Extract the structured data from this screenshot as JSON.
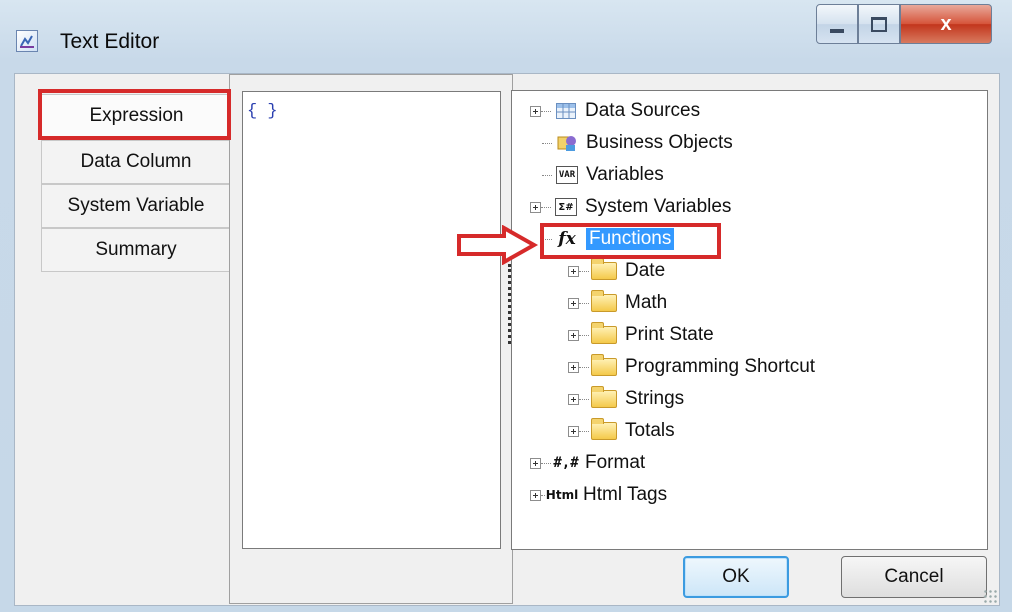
{
  "window": {
    "title": "Text Editor",
    "minimize_icon": "minimize-icon",
    "maximize_icon": "maximize-icon",
    "close_label": "x"
  },
  "tabs": [
    {
      "label": "Expression",
      "active": true
    },
    {
      "label": "Data Column",
      "active": false
    },
    {
      "label": "System Variable",
      "active": false
    },
    {
      "label": "Summary",
      "active": false
    }
  ],
  "expression": {
    "value": "{ }"
  },
  "tree": [
    {
      "label": "Data Sources",
      "icon": "table-icon",
      "expandable": true
    },
    {
      "label": "Business Objects",
      "icon": "business-objects-icon",
      "expandable": false
    },
    {
      "label": "Variables",
      "icon": "var-icon",
      "icon_text": "VAR",
      "expandable": false
    },
    {
      "label": "System Variables",
      "icon": "system-variables-icon",
      "icon_text": "Σ#",
      "expandable": true
    },
    {
      "label": "Functions",
      "icon": "fx-icon",
      "icon_text": "fx",
      "expandable": false,
      "selected": true,
      "children": [
        {
          "label": "Date"
        },
        {
          "label": "Math"
        },
        {
          "label": "Print State"
        },
        {
          "label": "Programming Shortcut"
        },
        {
          "label": "Strings"
        },
        {
          "label": "Totals"
        }
      ]
    },
    {
      "label": "Format",
      "icon": "format-icon",
      "icon_text": "#,#",
      "expandable": true
    },
    {
      "label": "Html Tags",
      "icon": "html-icon",
      "icon_text": "Html",
      "expandable": true
    }
  ],
  "buttons": {
    "ok": "OK",
    "cancel": "Cancel"
  },
  "colors": {
    "highlight": "#d62a2a",
    "selection": "#3399ff"
  }
}
